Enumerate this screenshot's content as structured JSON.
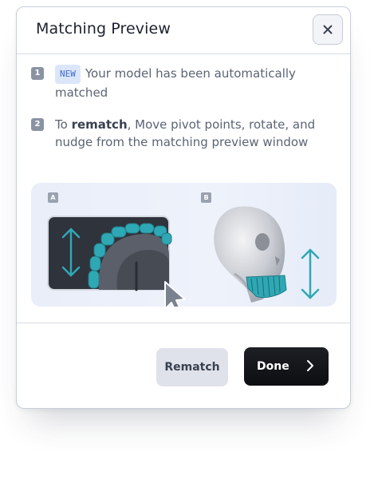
{
  "dialog": {
    "title": "Matching Preview",
    "close_icon": "close-icon"
  },
  "steps": [
    {
      "number": "1",
      "badge": "NEW",
      "text": "Your model has been automatically matched"
    },
    {
      "number": "2",
      "prefix": "To ",
      "bold": "rematch",
      "text": ", Move pivot points, rotate, and nudge from the matching preview window"
    }
  ],
  "illustration": {
    "panel_a": {
      "tag": "A",
      "icons": [
        "vertical-arrows-icon",
        "cursor-icon"
      ]
    },
    "panel_b": {
      "tag": "B",
      "icons": [
        "vertical-arrows-icon"
      ]
    }
  },
  "footer": {
    "rematch_label": "Rematch",
    "done_label": "Done",
    "done_icon": "chevron-right-icon"
  },
  "colors": {
    "accent_teal": "#2fa8b5",
    "done_bg": "#111216",
    "badge_bg": "#dbe6fb"
  }
}
